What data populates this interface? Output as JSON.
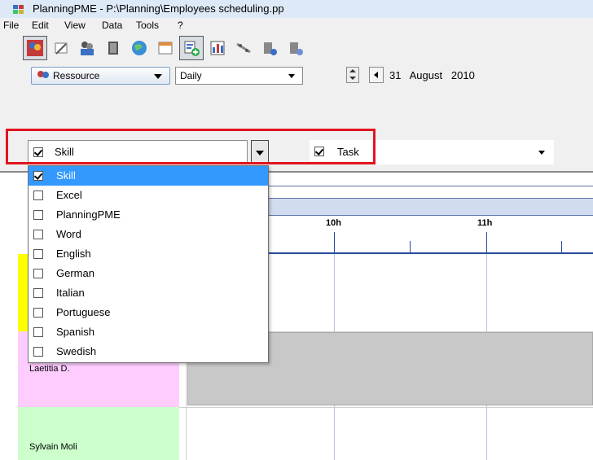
{
  "window": {
    "title": "PlanningPME - P:\\Planning\\Employees scheduling.pp"
  },
  "menu": [
    "File",
    "Edit",
    "View",
    "Data",
    "Tools",
    "?"
  ],
  "toolbar": {
    "icons": [
      "resources-icon",
      "notes-icon",
      "users-icon",
      "book-icon",
      "globe-icon",
      "calendar-icon",
      "add-task-icon",
      "chart-icon",
      "link-icon",
      "people-icon",
      "person-icon"
    ],
    "resource_button_label": "Ressource",
    "view_mode": "Daily",
    "date": {
      "day": "31",
      "month": "August",
      "year": "2010"
    }
  },
  "filters": {
    "skill_label": "Skill",
    "task_label": "Task"
  },
  "dropdown": {
    "items": [
      {
        "label": "Skill",
        "checked": true,
        "selected": true
      },
      {
        "label": "Excel",
        "checked": false
      },
      {
        "label": "PlanningPME",
        "checked": false
      },
      {
        "label": "Word",
        "checked": false
      },
      {
        "label": "English",
        "checked": false
      },
      {
        "label": "German",
        "checked": false
      },
      {
        "label": "Italian",
        "checked": false
      },
      {
        "label": "Portuguese",
        "checked": false
      },
      {
        "label": "Spanish",
        "checked": false
      },
      {
        "label": "Swedish",
        "checked": false
      }
    ]
  },
  "planning": {
    "hours": [
      "10h",
      "11h"
    ],
    "resources": [
      {
        "name": "",
        "color": "#ffff00"
      },
      {
        "name": "Laetitia D.",
        "color": "#ffccff"
      },
      {
        "name": "Sylvain Moli",
        "color": "#ccffcc"
      }
    ]
  },
  "colors": {
    "highlight": "#e0151f",
    "selection": "#3399ff",
    "timeline": "#274c9c"
  }
}
